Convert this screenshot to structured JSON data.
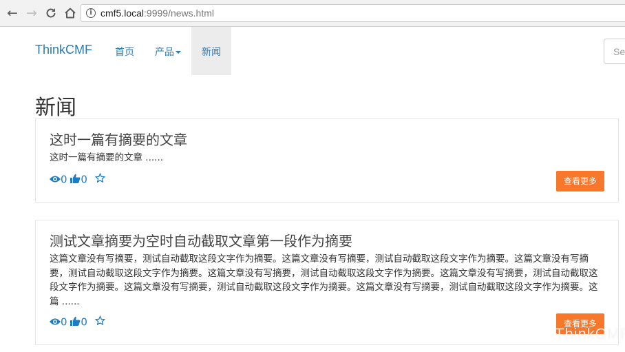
{
  "browser": {
    "url_host": "cmf5.local",
    "url_path": ":9999/news.html"
  },
  "site": {
    "brand": "ThinkCMF",
    "nav": {
      "home": "首页",
      "products": "产品",
      "news": "新闻"
    },
    "search_placeholder": "Search"
  },
  "page": {
    "title": "新闻",
    "articles": [
      {
        "title": "这时一篇有摘要的文章",
        "excerpt": "这时一篇有摘要的文章 ......",
        "views": "0",
        "likes": "0",
        "more_label": "查看更多"
      },
      {
        "title": "测试文章摘要为空时自动截取文章第一段作为摘要",
        "excerpt": "这篇文章没有写摘要，测试自动截取这段文字作为摘要。这篇文章没有写摘要，测试自动截取这段文字作为摘要。这篇文章没有写摘要，测试自动截取这段文字作为摘要。这篇文章没有写摘要，测试自动截取这段文字作为摘要。这篇文章没有写摘要，测试自动截取这段文字作为摘要。这篇文章没有写摘要，测试自动截取这段文字作为摘要。这篇文章没有写摘要，测试自动截取这段文字作为摘要。这篇 ......",
        "views": "0",
        "likes": "0",
        "more_label": "查看更多"
      }
    ]
  },
  "watermark": "ThinkCMF",
  "colors": {
    "link": "#2a7bb6",
    "accent": "#f7782b",
    "stat": "#1e7cc2"
  },
  "icons": {
    "back": "arrow-left-icon",
    "forward": "arrow-right-icon",
    "reload": "reload-icon",
    "home": "home-icon",
    "info": "info-icon",
    "views": "eye-icon",
    "likes": "thumbs-up-icon",
    "favorite": "star-icon"
  }
}
